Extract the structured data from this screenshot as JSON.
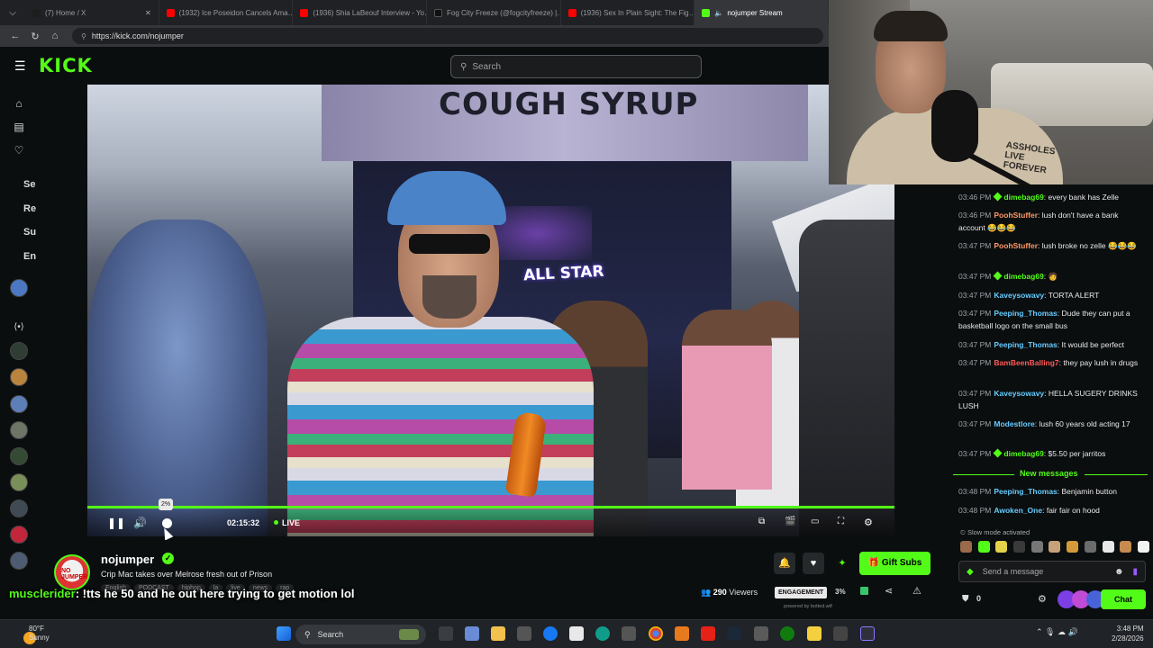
{
  "browser": {
    "tabs": [
      {
        "label": "(7) Home / X",
        "color": "#1d1d1d"
      },
      {
        "label": "(1932) Ice Poseidon Cancels Ama…",
        "color": "#ff0000"
      },
      {
        "label": "(1936) Shia LaBeouf Interview - Yo…",
        "color": "#ff0000"
      },
      {
        "label": "Fog City Freeze (@fogcityfreeze) |…",
        "color": "#111111"
      },
      {
        "label": "(1936) Sex In Plain Sight: The Fig…",
        "color": "#ff0000"
      },
      {
        "label": "nojumper Stream",
        "color": "#53fc18"
      }
    ],
    "url": "https://kick.com/nojumper"
  },
  "header": {
    "logo": "KICK",
    "search_placeholder": "Search"
  },
  "sidebar": {
    "labels": [
      "Se",
      "Re",
      "Su",
      "En"
    ]
  },
  "player": {
    "volume_tooltip": "2%",
    "volume_fraction": 0.02,
    "timecode": "02:15:32",
    "live_label": "LIVE",
    "progress_fraction": 1.0,
    "video_sign_text": "COUGH SYRUP",
    "video_allstar_text": "ALL STAR"
  },
  "webcam": {
    "shirt_text": "ASSHOLES LIVE FOREVER"
  },
  "chat": {
    "messages": [
      {
        "time": "03:46 PM",
        "badge": true,
        "user": "dimebag69",
        "user_color": "#53fc18",
        "text": "every bank has Zelle"
      },
      {
        "time": "03:46 PM",
        "badge": false,
        "user": "PoohStuffer",
        "user_color": "#ff9966",
        "text": "lush don't have a bank account 😂😂😂"
      },
      {
        "time": "03:47 PM",
        "badge": false,
        "user": "PoohStuffer",
        "user_color": "#ff9966",
        "text": "lush broke no zelle 😂😂😂"
      },
      {
        "time": "03:47 PM",
        "badge": true,
        "user": "dimebag69",
        "user_color": "#53fc18",
        "text": "🧑"
      },
      {
        "time": "03:47 PM",
        "badge": false,
        "user": "Kaveysowavy",
        "user_color": "#66ccff",
        "text": "TORTA ALERT"
      },
      {
        "time": "03:47 PM",
        "badge": false,
        "user": "Peeping_Thomas",
        "user_color": "#66ccff",
        "text": "Dude they can put a basketball logo on the small bus"
      },
      {
        "time": "03:47 PM",
        "badge": false,
        "user": "Peeping_Thomas",
        "user_color": "#66ccff",
        "text": "It would be perfect"
      },
      {
        "time": "03:47 PM",
        "badge": false,
        "user": "BamBeenBalling7",
        "user_color": "#ff5a5a",
        "text": "they pay lush in drugs"
      },
      {
        "time": "03:47 PM",
        "badge": false,
        "user": "Kaveysowavy",
        "user_color": "#66ccff",
        "text": "HELLA SUGERY DRINKS LUSH"
      },
      {
        "time": "03:47 PM",
        "badge": false,
        "user": "Modestlore",
        "user_color": "#66ccff",
        "text": "lush 60 years old acting 17"
      },
      {
        "time": "03:47 PM",
        "badge": true,
        "user": "dimebag69",
        "user_color": "#53fc18",
        "text": "$5.50 per jarritos"
      },
      {
        "time": "03:48 PM",
        "badge": false,
        "user": "Peeping_Thomas",
        "user_color": "#66ccff",
        "text": "Benjamin button"
      },
      {
        "time": "03:48 PM",
        "badge": false,
        "user": "Awoken_One",
        "user_color": "#66ccff",
        "text": "fair fair on hood"
      }
    ],
    "new_messages_label": "New messages",
    "slow_mode": "Slow mode activated",
    "input_placeholder": "Send a message",
    "points": "0",
    "chat_button": "Chat"
  },
  "stream": {
    "streamer": "nojumper",
    "title": "Crip Mac takes over Melrose fresh out of Prison",
    "tags": [
      "English",
      "PODCAST",
      "hiphop",
      "la",
      "live",
      "news",
      "rap"
    ],
    "gift_label": "Gift Subs",
    "viewers": "290",
    "viewers_label": "Viewers",
    "engagement_label": "ENGAGEMENT",
    "engagement_value": "3%",
    "powered_by": "powered by botted.wtf",
    "avatar_text": "NO JUMPER"
  },
  "overlay": {
    "user": "musclerider",
    "text": ": !tts he 50 and he out here trying to get motion lol"
  },
  "taskbar": {
    "temp": "80°F",
    "condition": "Sunny",
    "search": "Search",
    "time": "3:48 PM",
    "date": "2/28/2026"
  }
}
